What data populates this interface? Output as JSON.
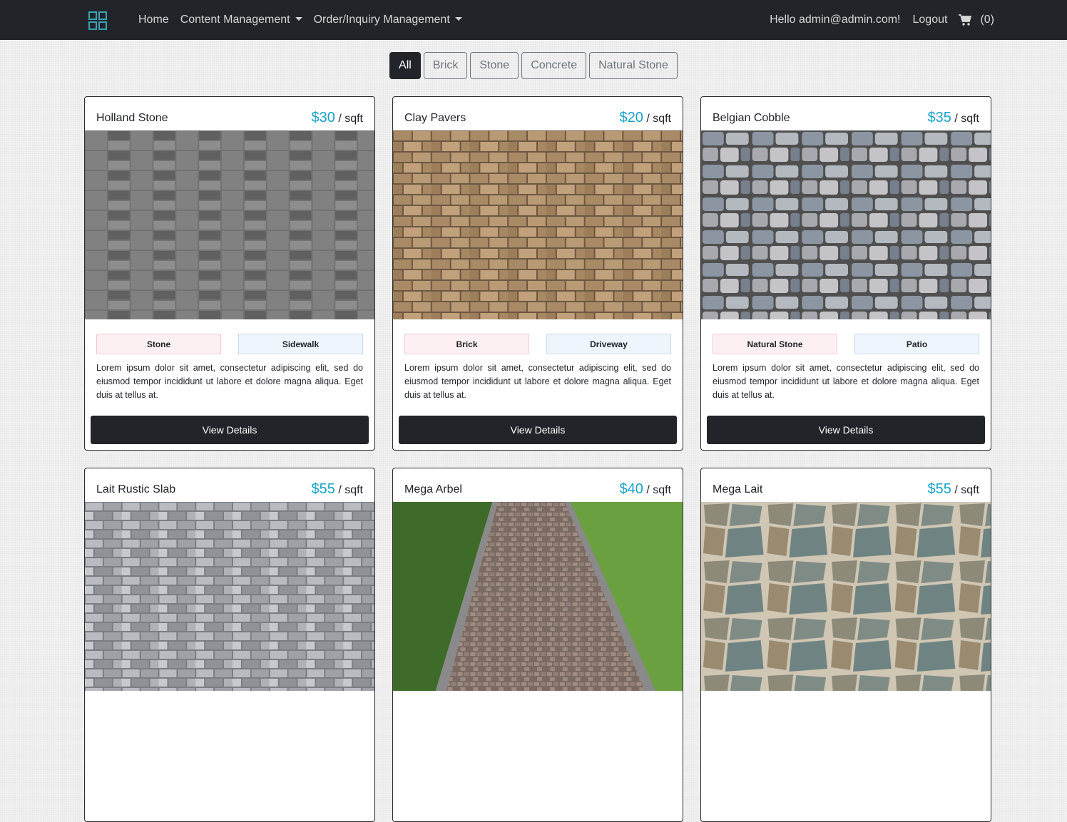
{
  "nav": {
    "home": "Home",
    "content_management": "Content Management",
    "order_management": "Order/Inquiry Management",
    "greeting": "Hello admin@admin.com!",
    "logout": "Logout",
    "cart_count": "(0)",
    "brand_icon": "grid-icon",
    "cart_icon": "cart-icon"
  },
  "filters": [
    "All",
    "Brick",
    "Stone",
    "Concrete",
    "Natural Stone"
  ],
  "active_filter": "All",
  "colors": {
    "navbar": "#212529",
    "price": "#17a2c8",
    "tag_category": "#fdf0f3",
    "tag_use": "#eef5fc"
  },
  "products": [
    {
      "name": "Holland Stone",
      "price": "$30",
      "unit": " / sqft",
      "category": "Stone",
      "use": "Sidewalk",
      "description": "Lorem ipsum dolor sit amet, consectetur adipiscing elit, sed do eiusmod tempor incididunt ut labore et dolore magna aliqua. Eget duis at tellus at.",
      "button": "View Details"
    },
    {
      "name": "Clay Pavers",
      "price": "$20",
      "unit": " / sqft",
      "category": "Brick",
      "use": "Driveway",
      "description": "Lorem ipsum dolor sit amet, consectetur adipiscing elit, sed do eiusmod tempor incididunt ut labore et dolore magna aliqua. Eget duis at tellus at.",
      "button": "View Details"
    },
    {
      "name": "Belgian Cobble",
      "price": "$35",
      "unit": " / sqft",
      "category": "Natural Stone",
      "use": "Patio",
      "description": "Lorem ipsum dolor sit amet, consectetur adipiscing elit, sed do eiusmod tempor incididunt ut labore et dolore magna aliqua. Eget duis at tellus at.",
      "button": "View Details"
    },
    {
      "name": "Lait Rustic Slab",
      "price": "$55",
      "unit": " / sqft"
    },
    {
      "name": "Mega Arbel",
      "price": "$40",
      "unit": " / sqft"
    },
    {
      "name": "Mega Lait",
      "price": "$55",
      "unit": " / sqft"
    }
  ]
}
